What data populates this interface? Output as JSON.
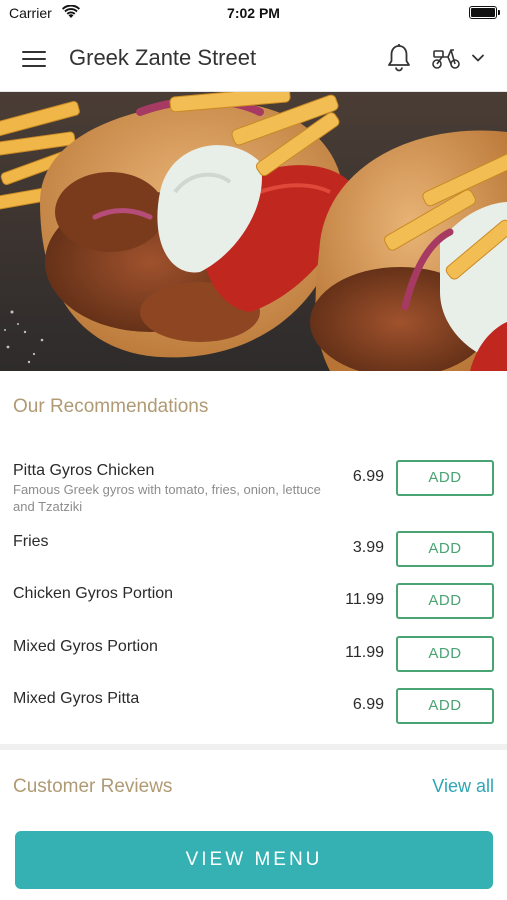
{
  "status_bar": {
    "carrier": "Carrier",
    "time": "7:02 PM"
  },
  "header": {
    "title": "Greek Zante Street"
  },
  "hero": {
    "image": "gyros-pitta-photo"
  },
  "recommendations": {
    "title": "Our Recommendations",
    "add_label": "ADD",
    "items": [
      {
        "name": "Pitta Gyros Chicken",
        "description": "Famous Greek gyros with tomato, fries, onion, lettuce and Tzatziki",
        "price": "6.99"
      },
      {
        "name": "Fries",
        "description": "",
        "price": "3.99"
      },
      {
        "name": "Chicken Gyros Portion",
        "description": "",
        "price": "11.99"
      },
      {
        "name": "Mixed Gyros Portion",
        "description": "",
        "price": "11.99"
      },
      {
        "name": "Mixed Gyros Pitta",
        "description": "",
        "price": "6.99"
      }
    ]
  },
  "reviews": {
    "title": "Customer Reviews",
    "view_all": "View all"
  },
  "footer": {
    "view_menu": "VIEW MENU"
  },
  "colors": {
    "accent_teal": "#35b1b4",
    "add_green": "#4aa373",
    "section_gold": "#b09a74",
    "link_teal": "#2fa6b5"
  }
}
